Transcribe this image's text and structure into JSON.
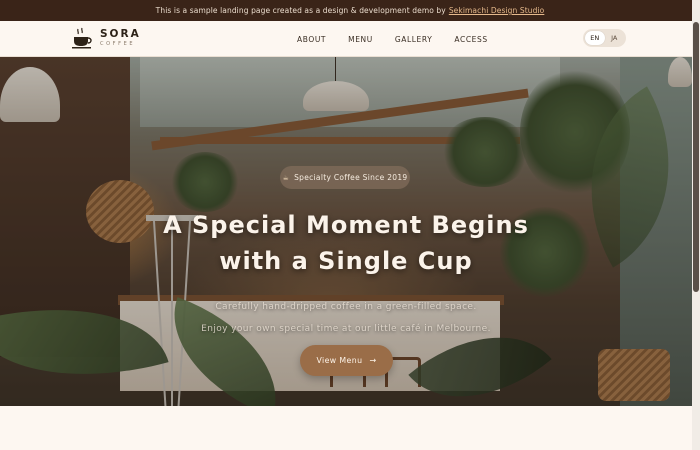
{
  "announcement": {
    "text": "This is a sample landing page created as a design & development demo by",
    "link_label": "Sekimachi Design Studio"
  },
  "header": {
    "brand_name": "SORA",
    "brand_sub": "COFFEE",
    "logo_icon": "coffee-cup-icon",
    "nav": [
      {
        "label": "ABOUT"
      },
      {
        "label": "MENU"
      },
      {
        "label": "GALLERY"
      },
      {
        "label": "ACCESS"
      }
    ],
    "lang": {
      "options": [
        "EN",
        "JA"
      ],
      "active": "EN"
    }
  },
  "hero": {
    "badge": "Specialty Coffee Since 2019",
    "headline_line1": "A Special Moment Begins",
    "headline_line2": "with a Single Cup",
    "sub_line1": "Carefully hand-dripped coffee in a green-filled space.",
    "sub_line2": "Enjoy your own special time at our little café in Melbourne.",
    "cta_label": "View Menu",
    "cta_icon": "arrow-right-icon"
  },
  "colors": {
    "announcement_bg": "#3a2418",
    "link": "#e5b98c",
    "header_bg": "#fdf7f1",
    "cta": "#9a6d48",
    "text_dark": "#2d2218"
  }
}
